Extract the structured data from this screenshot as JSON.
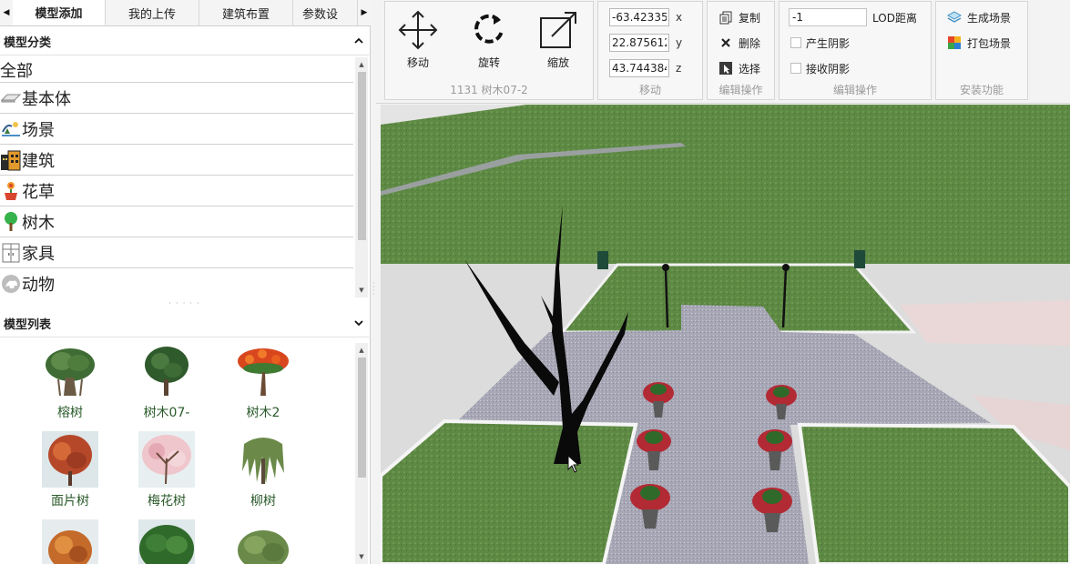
{
  "tabs": [
    {
      "label": "模型添加",
      "active": true
    },
    {
      "label": "我的上传",
      "active": false
    },
    {
      "label": "建筑布置",
      "active": false
    },
    {
      "label": "参数设",
      "active": false
    }
  ],
  "category_section": {
    "title": "模型分类"
  },
  "categories": [
    {
      "label": "全部",
      "icon": "none"
    },
    {
      "label": "基本体",
      "icon": "basic-shape-icon"
    },
    {
      "label": "场景",
      "icon": "scene-icon"
    },
    {
      "label": "建筑",
      "icon": "building-icon"
    },
    {
      "label": "花草",
      "icon": "flower-icon"
    },
    {
      "label": "树木",
      "icon": "tree-icon"
    },
    {
      "label": "家具",
      "icon": "furniture-icon"
    },
    {
      "label": "动物",
      "icon": "animal-icon"
    }
  ],
  "model_section": {
    "title": "模型列表"
  },
  "models": [
    {
      "label": "榕树",
      "icon": "banyan-tree-thumbnail"
    },
    {
      "label": "树木07-",
      "icon": "tree07-thumbnail"
    },
    {
      "label": "树木2",
      "icon": "red-flower-tree-thumbnail"
    },
    {
      "label": "面片树",
      "icon": "autumn-tree-thumbnail"
    },
    {
      "label": "梅花树",
      "icon": "plum-blossom-tree-thumbnail"
    },
    {
      "label": "柳树",
      "icon": "willow-tree-thumbnail"
    },
    {
      "label": "",
      "icon": "maple-tree-thumbnail"
    },
    {
      "label": "",
      "icon": "green-tree-thumbnail"
    },
    {
      "label": "",
      "icon": "bush-tree-thumbnail"
    }
  ],
  "toolbar": {
    "transform": {
      "move_label": "移动",
      "rotate_label": "旋转",
      "scale_label": "缩放",
      "caption": "1131 树木07-2"
    },
    "position": {
      "x_value": "-63.42335",
      "y_value": "22.875612",
      "z_value": "43.744384",
      "x_axis": "x",
      "y_axis": "y",
      "z_axis": "z",
      "caption": "移动"
    },
    "edit": {
      "copy_label": "复制",
      "delete_label": "删除",
      "select_label": "选择",
      "caption": "编辑操作"
    },
    "render": {
      "lod_value": "-1",
      "lod_label": "LOD距离",
      "cast_shadow_label": "产生阴影",
      "receive_shadow_label": "接收阴影",
      "cast_shadow_checked": false,
      "receive_shadow_checked": false,
      "caption": "编辑操作"
    },
    "install": {
      "generate_label": "生成场景",
      "package_label": "打包场景",
      "caption": "安装功能"
    }
  },
  "colors": {
    "grass": "#5f8a45",
    "path": "#a9a9b8",
    "tree_trunk": "#0a0a0a",
    "flower": "#c2263a",
    "label_green": "#2a5a2a"
  }
}
